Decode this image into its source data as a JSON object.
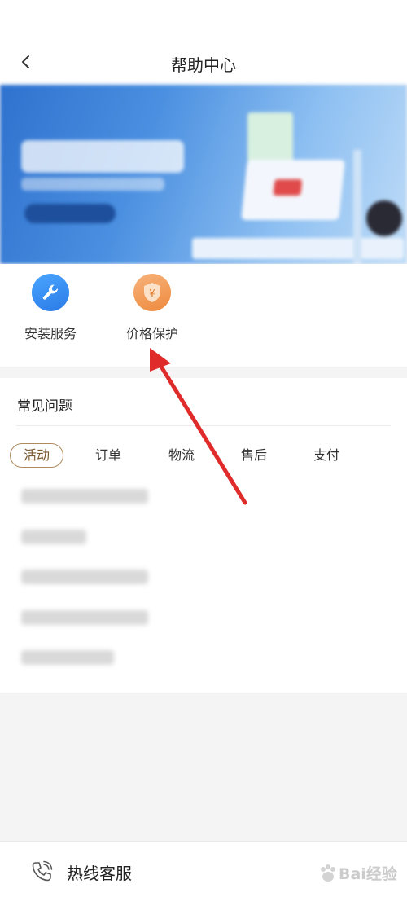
{
  "header": {
    "title": "帮助中心",
    "back_icon": "chevron-left-icon"
  },
  "banner": {
    "description": "blurred promotional banner"
  },
  "services": [
    {
      "label": "安装服务",
      "icon": "wrench-icon",
      "color": "#3d8ff5"
    },
    {
      "label": "价格保护",
      "icon": "yuan-shield-icon",
      "color": "#f09a52"
    }
  ],
  "faq": {
    "title": "常见问题",
    "tabs": [
      "活动",
      "订单",
      "物流",
      "售后",
      "支付"
    ],
    "active_tab": "活动"
  },
  "footer": {
    "hotline_label": "热线客服",
    "hotline_icon": "phone-icon"
  },
  "watermark": {
    "text": "Bai经验"
  },
  "colors": {
    "accent": "#b08a5c",
    "annotation_arrow": "#e02b2b"
  }
}
